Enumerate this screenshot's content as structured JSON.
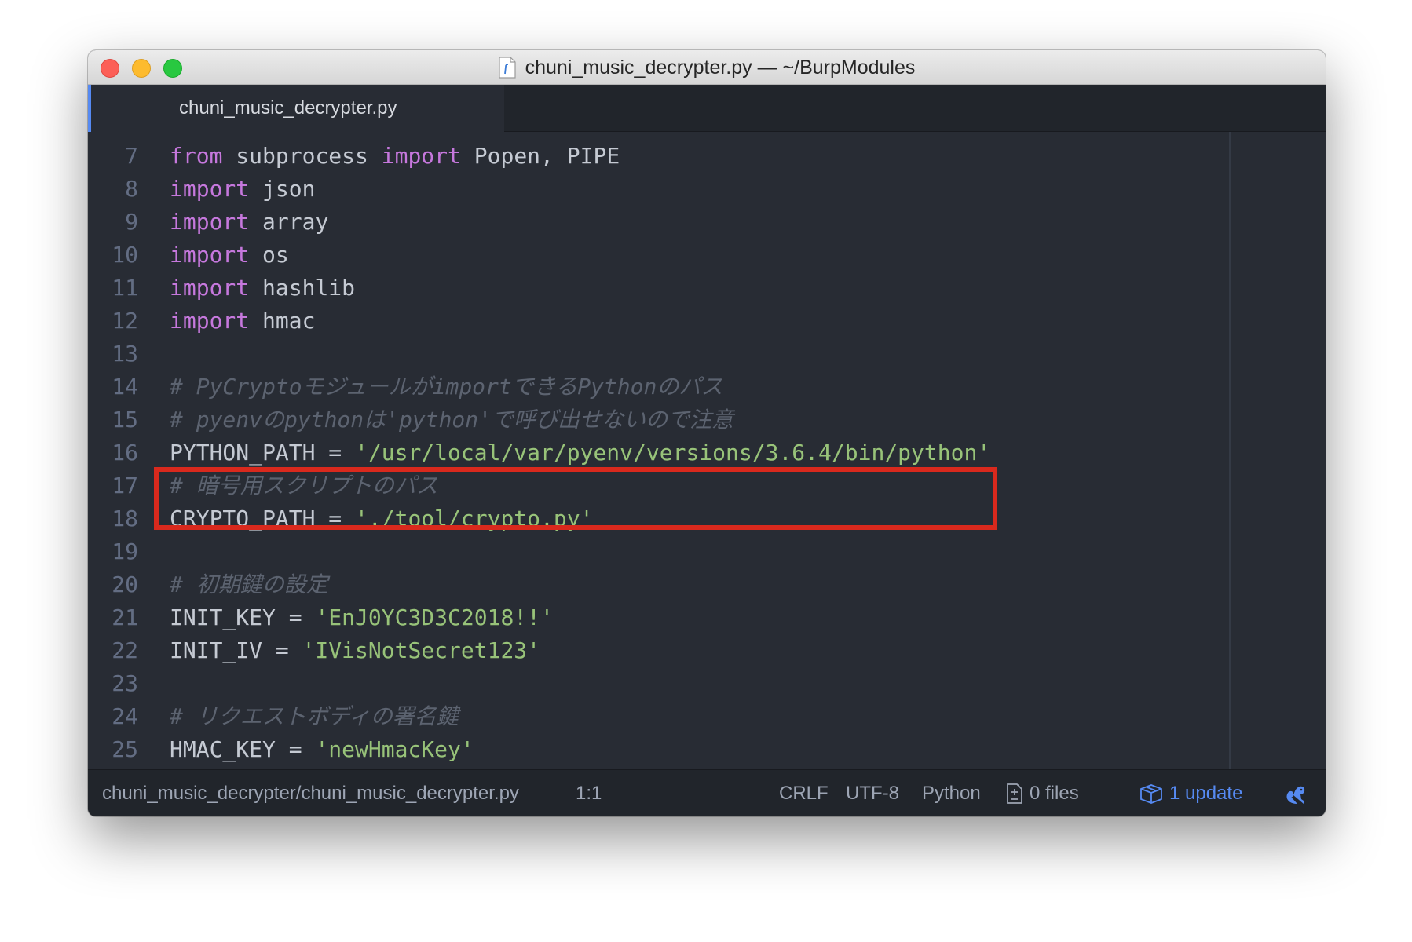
{
  "window": {
    "title": "chuni_music_decrypter.py — ~/BurpModules"
  },
  "tabs": [
    {
      "label": "chuni_music_decrypter.py",
      "active": true
    }
  ],
  "editor": {
    "lines": [
      {
        "num": "7",
        "tokens": [
          {
            "t": "from",
            "c": "kw"
          },
          {
            "t": " subprocess ",
            "c": ""
          },
          {
            "t": "import",
            "c": "kw"
          },
          {
            "t": " Popen, PIPE",
            "c": ""
          }
        ]
      },
      {
        "num": "8",
        "tokens": [
          {
            "t": "import",
            "c": "kw"
          },
          {
            "t": " json",
            "c": ""
          }
        ]
      },
      {
        "num": "9",
        "tokens": [
          {
            "t": "import",
            "c": "kw"
          },
          {
            "t": " array",
            "c": ""
          }
        ]
      },
      {
        "num": "10",
        "tokens": [
          {
            "t": "import",
            "c": "kw"
          },
          {
            "t": " os",
            "c": ""
          }
        ]
      },
      {
        "num": "11",
        "tokens": [
          {
            "t": "import",
            "c": "kw"
          },
          {
            "t": " hashlib",
            "c": ""
          }
        ]
      },
      {
        "num": "12",
        "tokens": [
          {
            "t": "import",
            "c": "kw"
          },
          {
            "t": " hmac",
            "c": ""
          }
        ]
      },
      {
        "num": "13",
        "tokens": []
      },
      {
        "num": "14",
        "tokens": [
          {
            "t": "# PyCryptoモジュールがimportできるPythonのパス",
            "c": "cm"
          }
        ]
      },
      {
        "num": "15",
        "tokens": [
          {
            "t": "# pyenvのpythonは'python'で呼び出せないので注意",
            "c": "cm"
          }
        ]
      },
      {
        "num": "16",
        "tokens": [
          {
            "t": "PYTHON_PATH = ",
            "c": ""
          },
          {
            "t": "'/usr/local/var/pyenv/versions/3.6.4/bin/python'",
            "c": "str"
          }
        ]
      },
      {
        "num": "17",
        "tokens": [
          {
            "t": "# 暗号用スクリプトのパス",
            "c": "cm"
          }
        ]
      },
      {
        "num": "18",
        "tokens": [
          {
            "t": "CRYPTO_PATH = ",
            "c": ""
          },
          {
            "t": "'./tool/crypto.py'",
            "c": "str"
          }
        ]
      },
      {
        "num": "19",
        "tokens": []
      },
      {
        "num": "20",
        "tokens": [
          {
            "t": "# 初期鍵の設定",
            "c": "cm"
          }
        ]
      },
      {
        "num": "21",
        "tokens": [
          {
            "t": "INIT_KEY = ",
            "c": ""
          },
          {
            "t": "'EnJ0YC3D3C2018!!'",
            "c": "str"
          }
        ]
      },
      {
        "num": "22",
        "tokens": [
          {
            "t": "INIT_IV = ",
            "c": ""
          },
          {
            "t": "'IVisNotSecret123'",
            "c": "str"
          }
        ]
      },
      {
        "num": "23",
        "tokens": []
      },
      {
        "num": "24",
        "tokens": [
          {
            "t": "# リクエストボディの署名鍵",
            "c": "cm"
          }
        ]
      },
      {
        "num": "25",
        "tokens": [
          {
            "t": "HMAC_KEY = ",
            "c": ""
          },
          {
            "t": "'newHmacKey'",
            "c": "str"
          }
        ]
      }
    ],
    "highlighted_line": "16"
  },
  "statusbar": {
    "path": "chuni_music_decrypter/chuni_music_decrypter.py",
    "cursor": "1:1",
    "line_ending": "CRLF",
    "encoding": "UTF-8",
    "grammar": "Python",
    "git_files": "0 files",
    "updates": "1 update"
  },
  "colors": {
    "keyword": "#c678dd",
    "string": "#98c379",
    "comment": "#5c6370",
    "text": "#c5cad3",
    "background": "#282c34",
    "highlight_box": "#d9291d",
    "accent": "#568af2"
  },
  "icons": {
    "title_file": "python-file-icon",
    "git_files": "file-diff-icon",
    "updates": "package-icon",
    "squirrel": "squirrel-icon"
  }
}
